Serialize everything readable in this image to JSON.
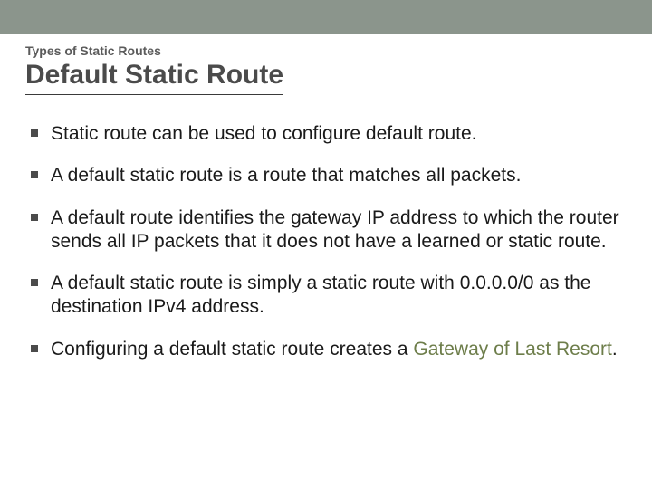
{
  "kicker": "Types of Static Routes",
  "title": "Default Static Route",
  "bullets": [
    {
      "text": "Static route can be used to configure default route."
    },
    {
      "text": "A default static route is a route that matches all packets."
    },
    {
      "text": "A default route identifies the gateway IP address to which the router sends all IP packets that it does not have a learned or static route."
    },
    {
      "text": "A default static route is simply a static route with 0.0.0.0/0 as the destination IPv4 address."
    },
    {
      "prefix": "Configuring a default static route creates a ",
      "highlight": "Gateway of Last Resort",
      "suffix": "."
    }
  ]
}
